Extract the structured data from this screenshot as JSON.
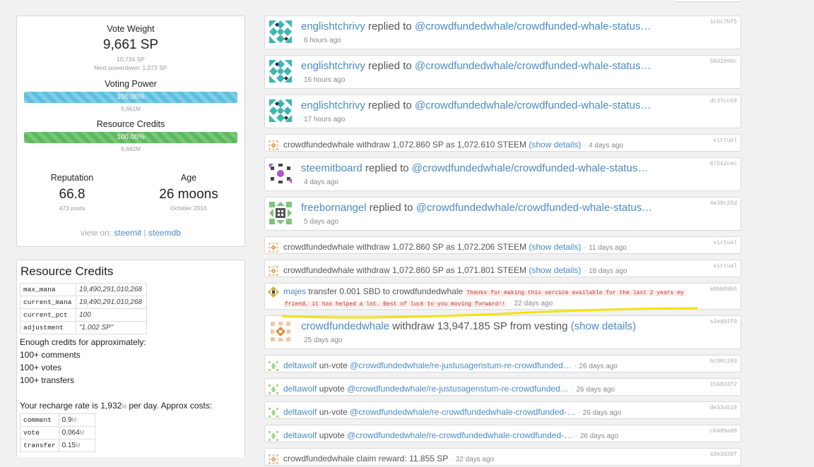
{
  "stats": {
    "vote_weight_label": "Vote Weight",
    "vote_weight_value": "9,661 SP",
    "vote_weight_sub": "10,734 SP",
    "next_powerdown": "Next powerdown: 1,073 SP",
    "voting_power_label": "Voting Power",
    "voting_power_pct": 100,
    "voting_power_text": "100.00%",
    "voting_power_sub": "9,661",
    "rc_label": "Resource Credits",
    "rc_pct": 100,
    "rc_text": "100.00%",
    "rc_sub": "9,662",
    "sub_unit": "M",
    "reputation_label": "Reputation",
    "reputation_value": "66.8",
    "reputation_sub": "473 posts",
    "age_label": "Age",
    "age_value": "26 moons",
    "age_sub": "October 2016",
    "view_on": "view on:",
    "link_steemit": "steemit",
    "link_separator": "|",
    "link_steemdb": "steemdb"
  },
  "resource_credits": {
    "title": "Resource Credits",
    "rows": [
      {
        "key": "max_mana",
        "value": "19,490,291,010,268"
      },
      {
        "key": "current_mana",
        "value": "19,490,291,010,268"
      },
      {
        "key": "current_pct",
        "value": "100"
      },
      {
        "key": "adjustment",
        "value": "\"1.002 SP\""
      }
    ],
    "enough_text": "Enough credits for approximately:",
    "capacity": [
      "100+ comments",
      "100+ votes",
      "100+ transfers"
    ],
    "recharge_prefix": "Your recharge rate is 1,932",
    "recharge_unit": "M",
    "recharge_suffix": " per day. Approx costs:",
    "costs": [
      {
        "op": "comment",
        "value": "0.9",
        "unit": "M"
      },
      {
        "op": "vote",
        "value": "0.064",
        "unit": "M"
      },
      {
        "op": "transfer",
        "value": "0.15",
        "unit": "M"
      }
    ]
  },
  "feed": [
    {
      "kind": "big",
      "avatar": "teal",
      "actor": "englishtchrivy",
      "verb": "replied to",
      "target": "@crowdfundedwhale/crowdfunded-whale-status…",
      "time": "6 hours ago",
      "hash": "1cbc7bf5"
    },
    {
      "kind": "big",
      "avatar": "teal",
      "actor": "englishtchrivy",
      "verb": "replied to",
      "target": "@crowdfundedwhale/crowdfunded-whale-status…",
      "time": "16 hours ago",
      "hash": "58d2990c"
    },
    {
      "kind": "big",
      "avatar": "teal",
      "actor": "englishtchrivy",
      "verb": "replied to",
      "target": "@crowdfundedwhale/crowdfunded-whale-status…",
      "time": "17 hours ago",
      "hash": "dc37cc69"
    },
    {
      "kind": "small",
      "avatar": "orange",
      "actor": "crowdfundedwhale",
      "text": "withdraw 1,072.860 SP as 1,072.610 STEEM",
      "link": "(show details)",
      "time": "4 days ago",
      "hash": "virtual"
    },
    {
      "kind": "big",
      "avatar": "purple",
      "actor": "steemitboard",
      "verb": "replied to",
      "target": "@crowdfundedwhale/crowdfunded-whale-status…",
      "time": "4 days ago",
      "hash": "87512cec"
    },
    {
      "kind": "big",
      "avatar": "green",
      "actor": "freebornangel",
      "verb": "replied to",
      "target": "@crowdfundedwhale/crowdfunded-whale-status…",
      "time": "5 days ago",
      "hash": "4a38c25d"
    },
    {
      "kind": "small",
      "avatar": "orange",
      "actor": "crowdfundedwhale",
      "text": "withdraw 1,072.860 SP as 1,072.206 STEEM",
      "link": "(show details)",
      "time": "11 days ago",
      "hash": "virtual"
    },
    {
      "kind": "small",
      "avatar": "orange",
      "actor": "crowdfundedwhale",
      "text": "withdraw 1,072.860 SP as 1,071.801 STEEM",
      "link": "(show details)",
      "time": "18 days ago",
      "hash": "virtual"
    },
    {
      "kind": "transfer",
      "avatar": "olive",
      "actor": "majes",
      "text": "transfer 0.001 SBD to crowdfundedwhale",
      "memo1": "Thanks for making this sercice available for the last 2 years my",
      "memo2": "friend, it has helped a lot. Best of luck to you moving forward!!",
      "time": "22 days ago",
      "hash": "e8bb09b5"
    },
    {
      "kind": "big",
      "avatar": "orange",
      "actor": "crowdfundedwhale",
      "verb": "withdraw 13,947.185 SP from vesting",
      "target": "(show details)",
      "time": "25 days ago",
      "hash": "a2ed92f0"
    },
    {
      "kind": "small",
      "avatar": "lime",
      "actor": "deltawolf",
      "text": "un-vote",
      "link": "@crowdfundedwhale/re-justusagenstum-re-crowdfunded…",
      "time": "26 days ago",
      "hash": "6c98c29d"
    },
    {
      "kind": "small",
      "avatar": "lime",
      "actor": "deltawolf",
      "text": "upvote",
      "link": "@crowdfundedwhale/re-justusagenstum-re-crowdfunded…",
      "time": "26 days ago",
      "hash": "156833f2"
    },
    {
      "kind": "small",
      "avatar": "lime",
      "actor": "deltawolf",
      "text": "un-vote",
      "link": "@crowdfundedwhale/re-crowdfundedwhale-crowdfunded-…",
      "time": "26 days ago",
      "hash": "de33a518"
    },
    {
      "kind": "small",
      "avatar": "lime",
      "actor": "deltawolf",
      "text": "upvote",
      "link": "@crowdfundedwhale/re-crowdfundedwhale-crowdfunded-…",
      "time": "26 days ago",
      "hash": "cb489a88"
    },
    {
      "kind": "small",
      "avatar": "orange",
      "actor": "crowdfundedwhale",
      "text": "claim reward: 11.855 SP",
      "link": "",
      "time": "32 days ago",
      "hash": "a3e2d38f"
    }
  ],
  "colors": {
    "link": "#4a8bc5",
    "bar_blue": "#5bc0de",
    "bar_green": "#5cb85c",
    "highlight": "#f4e20c",
    "memo": "#c0392b"
  }
}
